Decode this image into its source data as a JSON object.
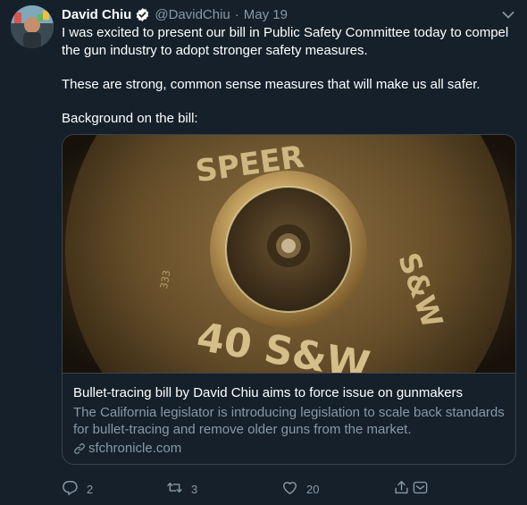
{
  "tweet": {
    "author_name": "David Chiu",
    "handle": "@DavidChiu",
    "separator": "·",
    "date": "May 19",
    "text_line_1": "I was excited to present our bill in Public Safety Committee today to compel the gun industry to adopt stronger safety measures.",
    "text_line_2": "These are strong, common sense measures that will make us all safer.",
    "text_line_3": "Background on the bill:"
  },
  "card": {
    "title": "Bullet-tracing bill by David Chiu aims to force issue on gunmakers",
    "description": "The California legislator is introducing legislation to scale back standards for bullet-tracing and remove older guns from the market.",
    "domain": "sfchronicle.com",
    "image_text": {
      "headstamp_top": "SPEER",
      "headstamp_right": "S&W",
      "headstamp_bottom": "40 S&W",
      "small_mark": "333"
    }
  },
  "actions": {
    "reply_count": "2",
    "retweet_count": "3",
    "like_count": "20"
  },
  "colors": {
    "background": "#15202b",
    "text_primary": "#ffffff",
    "text_secondary": "#8899a6",
    "border": "#38444d"
  }
}
